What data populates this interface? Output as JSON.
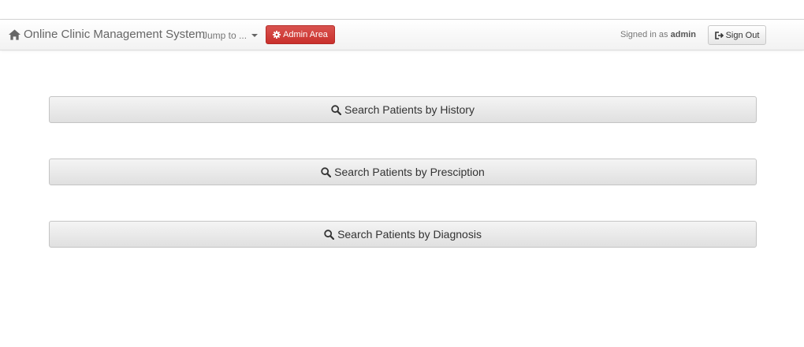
{
  "navbar": {
    "brand": "Online Clinic Management System",
    "jump_label": "Jump to ...",
    "admin_label": "Admin Area",
    "signed_in_prefix": "Signed in as ",
    "signed_in_user": "admin",
    "signout_label": "Sign Out",
    "icons": {
      "brand": "home-icon",
      "jump": "caret-down-icon",
      "admin": "cog-icon",
      "signout": "log-out-icon"
    },
    "colors": {
      "admin_button": "#d9534f"
    }
  },
  "main": {
    "search_buttons": [
      {
        "label": "Search Patients by History",
        "icon": "search-icon"
      },
      {
        "label": "Search Patients by Presciption",
        "icon": "search-icon"
      },
      {
        "label": "Search Patients by Diagnosis",
        "icon": "search-icon"
      }
    ]
  }
}
